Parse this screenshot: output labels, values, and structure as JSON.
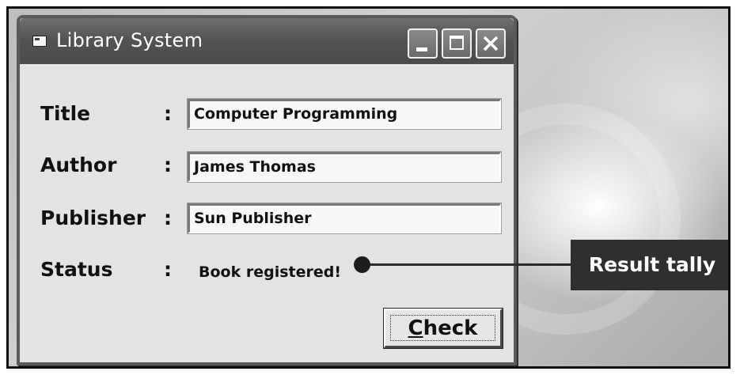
{
  "window": {
    "title": "Library System",
    "icon": "app-window-icon",
    "controls": [
      "minimize-icon",
      "maximize-icon",
      "close-icon"
    ]
  },
  "form": {
    "title": {
      "label": "Title",
      "separator": ":",
      "value": "Computer Programming"
    },
    "author": {
      "label": "Author",
      "separator": ":",
      "value": "James Thomas"
    },
    "publisher": {
      "label": "Publisher",
      "separator": ":",
      "value": "Sun Publisher"
    },
    "status": {
      "label": "Status",
      "separator": ":",
      "value": "Book registered!"
    }
  },
  "buttons": {
    "check_prefix": "C",
    "check_rest": "heck"
  },
  "annotation": {
    "callout_label": "Result tally"
  },
  "colors": {
    "titlebar": "#545454",
    "window_bg": "#e3e3e3",
    "callout_bg": "#2f2f2f"
  }
}
